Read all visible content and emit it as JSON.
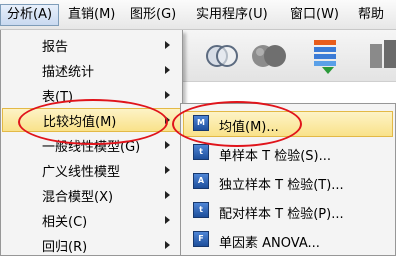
{
  "menubar": {
    "items": [
      {
        "label": "分析(A)",
        "active": true
      },
      {
        "label": "直销(M)"
      },
      {
        "label": "图形(G)"
      },
      {
        "label": "实用程序(U)"
      },
      {
        "label": "窗口(W)"
      },
      {
        "label": "帮助"
      }
    ]
  },
  "analyze_menu": {
    "items": [
      {
        "label": "报告",
        "submenu": true
      },
      {
        "label": "描述统计",
        "submenu": true
      },
      {
        "label": "表(T)",
        "submenu": true
      },
      {
        "label": "比较均值(M)",
        "submenu": true,
        "highlighted": true
      },
      {
        "label": "一般线性模型(G)",
        "submenu": true
      },
      {
        "label": "广义线性模型",
        "submenu": true
      },
      {
        "label": "混合模型(X)",
        "submenu": true
      },
      {
        "label": "相关(C)",
        "submenu": true
      },
      {
        "label": "回归(R)",
        "submenu": true
      }
    ]
  },
  "compare_means_submenu": {
    "items": [
      {
        "label": "均值(M)...",
        "icon": "means-icon",
        "icon_text": "M",
        "highlighted": true
      },
      {
        "label": "单样本 T 检验(S)...",
        "icon": "one-sample-t-icon",
        "icon_text": "t"
      },
      {
        "label": "独立样本 T 检验(T)...",
        "icon": "independent-t-icon",
        "icon_text": "A"
      },
      {
        "label": "配对样本 T 检验(P)...",
        "icon": "paired-t-icon",
        "icon_text": "t"
      },
      {
        "label": "单因素 ANOVA...",
        "icon": "anova-icon",
        "icon_text": "F"
      }
    ]
  },
  "toolbar": {
    "icons": [
      "venn-icon",
      "circles-icon",
      "variables-icon",
      "split-icon"
    ]
  },
  "colors": {
    "highlight": "#f9e28a",
    "annotation": "#e0141b",
    "icon_blue": "#1e4f9c"
  }
}
